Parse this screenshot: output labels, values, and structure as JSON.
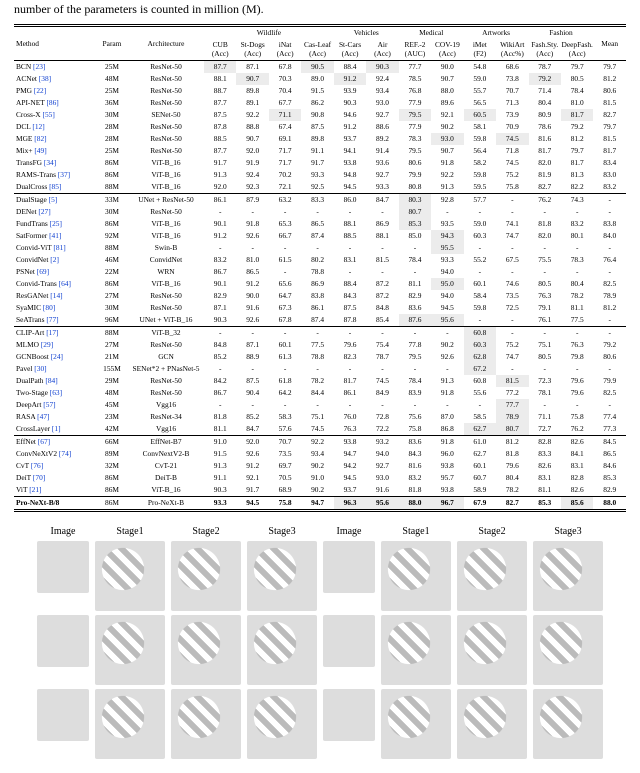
{
  "caption_tail": "number of the parameters is counted in million (M).",
  "head": {
    "method": "Method",
    "param": "Param",
    "arch": "Architecture",
    "groups": [
      {
        "name": "Wildlife",
        "cols": [
          [
            "CUB",
            "(Acc)"
          ],
          [
            "St-Dogs",
            "(Acc)"
          ],
          [
            "iNat",
            "(Acc)"
          ],
          [
            "Cas-Leaf",
            "(Acc)"
          ]
        ]
      },
      {
        "name": "Vehicles",
        "cols": [
          [
            "St-Cars",
            "(Acc)"
          ],
          [
            "Air",
            "(Acc)"
          ]
        ]
      },
      {
        "name": "Medical",
        "cols": [
          [
            "REF.-2",
            "(AUC)"
          ],
          [
            "COV-19",
            "(Acc)"
          ]
        ]
      },
      {
        "name": "Artworks",
        "cols": [
          [
            "iMet",
            "(F2)"
          ],
          [
            "WikiArt",
            "(Acc%)"
          ]
        ]
      },
      {
        "name": "Fashion",
        "cols": [
          [
            "Fash.Sty.",
            "(Acc)"
          ],
          [
            "DeepFash.",
            "(Acc)"
          ]
        ]
      }
    ],
    "mean": "Mean"
  },
  "chart_data": {
    "type": "table",
    "blocks": [
      [
        {
          "m": "BCN",
          "c": "[23]",
          "p": "25M",
          "a": "ResNet-50",
          "v": [
            "87.7",
            "87.1",
            "67.8",
            "90.5",
            "88.4",
            "90.3",
            "77.7",
            "90.0",
            "54.8",
            "68.6",
            "78.7",
            "79.7"
          ],
          "mean": "79.7",
          "hi": [
            0,
            3,
            5
          ]
        },
        {
          "m": "ACNet",
          "c": "[38]",
          "p": "48M",
          "a": "ResNet-50",
          "v": [
            "88.1",
            "90.7",
            "70.3",
            "89.0",
            "91.2",
            "92.4",
            "78.5",
            "90.7",
            "59.0",
            "73.8",
            "79.2",
            "80.5"
          ],
          "mean": "81.2",
          "hi": [
            1,
            4,
            10
          ]
        },
        {
          "m": "PMG",
          "c": "[22]",
          "p": "25M",
          "a": "ResNet-50",
          "v": [
            "88.7",
            "89.8",
            "70.4",
            "91.5",
            "93.9",
            "93.4",
            "76.8",
            "88.0",
            "55.7",
            "70.7",
            "71.4",
            "78.4"
          ],
          "mean": "80.6",
          "hi": []
        },
        {
          "m": "API-NET",
          "c": "[86]",
          "p": "36M",
          "a": "ResNet-50",
          "v": [
            "87.7",
            "89.1",
            "67.7",
            "86.2",
            "90.3",
            "93.0",
            "77.9",
            "89.6",
            "56.5",
            "71.3",
            "80.4",
            "81.0"
          ],
          "mean": "81.5",
          "hi": []
        },
        {
          "m": "Cross-X",
          "c": "[55]",
          "p": "30M",
          "a": "SENet-50",
          "v": [
            "87.5",
            "92.2",
            "71.1",
            "90.8",
            "94.6",
            "92.7",
            "79.5",
            "92.1",
            "60.5",
            "73.9",
            "80.9",
            "81.7"
          ],
          "mean": "82.7",
          "hi": [
            2,
            6,
            8,
            11
          ]
        },
        {
          "m": "DCL",
          "c": "[12]",
          "p": "28M",
          "a": "ResNet-50",
          "v": [
            "87.8",
            "88.8",
            "67.4",
            "87.5",
            "91.2",
            "88.6",
            "77.9",
            "90.2",
            "58.1",
            "70.9",
            "78.6",
            "79.2"
          ],
          "mean": "79.7",
          "hi": []
        },
        {
          "m": "MGE",
          "c": "[82]",
          "p": "28M",
          "a": "ResNet-50",
          "v": [
            "88.5",
            "90.7",
            "69.1",
            "89.8",
            "93.7",
            "89.2",
            "78.3",
            "93.0",
            "59.8",
            "74.5",
            "81.6",
            "81.2"
          ],
          "mean": "81.5",
          "hi": [
            7,
            9
          ]
        },
        {
          "m": "Mix+",
          "c": "[49]",
          "p": "25M",
          "a": "ResNet-50",
          "v": [
            "87.7",
            "92.0",
            "71.7",
            "91.1",
            "94.1",
            "91.4",
            "79.5",
            "90.7",
            "56.4",
            "71.8",
            "81.7",
            "79.7"
          ],
          "mean": "81.7",
          "hi": []
        },
        {
          "m": "TransFG",
          "c": "[34]",
          "p": "86M",
          "a": "ViT-B_16",
          "v": [
            "91.7",
            "91.9",
            "71.7",
            "91.7",
            "93.8",
            "93.6",
            "80.6",
            "91.8",
            "58.2",
            "74.5",
            "82.0",
            "81.7"
          ],
          "mean": "83.4",
          "hi": []
        },
        {
          "m": "RAMS-Trans",
          "c": "[37]",
          "p": "86M",
          "a": "ViT-B_16",
          "v": [
            "91.3",
            "92.4",
            "70.2",
            "93.3",
            "94.8",
            "92.7",
            "79.9",
            "92.2",
            "59.8",
            "75.2",
            "81.9",
            "81.3"
          ],
          "mean": "83.0",
          "hi": []
        },
        {
          "m": "DualCross",
          "c": "[85]",
          "p": "88M",
          "a": "ViT-B_16",
          "v": [
            "92.0",
            "92.3",
            "72.1",
            "92.5",
            "94.5",
            "93.3",
            "80.8",
            "91.3",
            "59.5",
            "75.8",
            "82.7",
            "82.2"
          ],
          "mean": "83.2",
          "hi": []
        }
      ],
      [
        {
          "m": "DualStage",
          "c": "[5]",
          "p": "33M",
          "a": "UNet + ResNet-50",
          "v": [
            "86.1",
            "87.9",
            "63.2",
            "83.3",
            "86.0",
            "84.7",
            "80.3",
            "92.8",
            "57.7",
            "-",
            "76.2",
            "74.3"
          ],
          "mean": "-",
          "hi": [
            6
          ]
        },
        {
          "m": "DENet",
          "c": "[27]",
          "p": "30M",
          "a": "ResNet-50",
          "v": [
            "-",
            "-",
            "-",
            "-",
            "-",
            "-",
            "80.7",
            "-",
            "-",
            "-",
            "-",
            "-"
          ],
          "mean": "-",
          "hi": [
            6
          ]
        },
        {
          "m": "FundTrans",
          "c": "[25]",
          "p": "86M",
          "a": "ViT-B_16",
          "v": [
            "90.1",
            "91.8",
            "65.3",
            "86.5",
            "88.1",
            "86.9",
            "85.3",
            "93.5",
            "59.0",
            "74.1",
            "81.8",
            "83.2"
          ],
          "mean": "83.8",
          "hi": [
            6
          ]
        },
        {
          "m": "SatFormer",
          "c": "[41]",
          "p": "92M",
          "a": "ViT-B_16",
          "v": [
            "91.2",
            "92.6",
            "66.7",
            "87.4",
            "88.5",
            "88.1",
            "85.0",
            "94.3",
            "60.3",
            "74.7",
            "82.0",
            "80.1"
          ],
          "mean": "84.0",
          "hi": [
            7
          ]
        },
        {
          "m": "Convid-ViT",
          "c": "[81]",
          "p": "88M",
          "a": "Swin-B",
          "v": [
            "-",
            "-",
            "-",
            "-",
            "-",
            "-",
            "-",
            "95.5",
            "-",
            "-",
            "-",
            "-"
          ],
          "mean": "-",
          "hi": [
            7
          ]
        },
        {
          "m": "ConvidNet",
          "c": "[2]",
          "p": "46M",
          "a": "ConvidNet",
          "v": [
            "83.2",
            "81.0",
            "61.5",
            "80.2",
            "83.1",
            "81.5",
            "78.4",
            "93.3",
            "55.2",
            "67.5",
            "75.5",
            "78.3"
          ],
          "mean": "76.4",
          "hi": []
        },
        {
          "m": "PSNet",
          "c": "[69]",
          "p": "22M",
          "a": "WRN",
          "v": [
            "86.7",
            "86.5",
            "-",
            "78.8",
            "-",
            "-",
            "-",
            "94.0",
            "-",
            "-",
            "-",
            "-"
          ],
          "mean": "-",
          "hi": []
        },
        {
          "m": "Convid-Trans",
          "c": "[64]",
          "p": "86M",
          "a": "ViT-B_16",
          "v": [
            "90.1",
            "91.2",
            "65.6",
            "86.9",
            "88.4",
            "87.2",
            "81.1",
            "95.0",
            "60.1",
            "74.6",
            "80.5",
            "80.4"
          ],
          "mean": "82.5",
          "hi": [
            7
          ]
        },
        {
          "m": "ResGANet",
          "c": "[14]",
          "p": "27M",
          "a": "ResNet-50",
          "v": [
            "82.9",
            "90.0",
            "64.7",
            "83.8",
            "84.3",
            "87.2",
            "82.9",
            "94.0",
            "58.4",
            "73.5",
            "76.3",
            "78.2"
          ],
          "mean": "78.9",
          "hi": []
        },
        {
          "m": "SyaMIC",
          "c": "[80]",
          "p": "30M",
          "a": "ResNet-50",
          "v": [
            "87.1",
            "91.6",
            "67.3",
            "86.1",
            "87.5",
            "84.8",
            "83.6",
            "94.5",
            "59.8",
            "72.5",
            "79.1",
            "81.1"
          ],
          "mean": "81.2",
          "hi": []
        },
        {
          "m": "SeATrans",
          "c": "[77]",
          "p": "96M",
          "a": "UNet + ViT-B_16",
          "v": [
            "90.3",
            "92.6",
            "67.8",
            "87.4",
            "87.8",
            "85.4",
            "87.6",
            "95.6",
            "-",
            "-",
            "76.1",
            "77.5"
          ],
          "mean": "-",
          "hi": [
            6,
            7
          ]
        }
      ],
      [
        {
          "m": "CLIP-Art",
          "c": "[17]",
          "p": "88M",
          "a": "ViT-B_32",
          "v": [
            "-",
            "-",
            "-",
            "-",
            "-",
            "-",
            "-",
            "-",
            "60.8",
            "-",
            "-",
            "-"
          ],
          "mean": "-",
          "hi": [
            8
          ]
        },
        {
          "m": "MLMO",
          "c": "[29]",
          "p": "27M",
          "a": "ResNet-50",
          "v": [
            "84.8",
            "87.1",
            "60.1",
            "77.5",
            "79.6",
            "75.4",
            "77.8",
            "90.2",
            "60.3",
            "75.2",
            "75.1",
            "76.3"
          ],
          "mean": "79.2",
          "hi": [
            8
          ]
        },
        {
          "m": "GCNBoost",
          "c": "[24]",
          "p": "21M",
          "a": "GCN",
          "v": [
            "85.2",
            "88.9",
            "61.3",
            "78.8",
            "82.3",
            "78.7",
            "79.5",
            "92.6",
            "62.8",
            "74.7",
            "80.5",
            "79.8"
          ],
          "mean": "80.6",
          "hi": [
            8
          ]
        },
        {
          "m": "Pavel",
          "c": "[30]",
          "p": "155M",
          "a": "SENet*2 + PNasNet-5",
          "v": [
            "-",
            "-",
            "-",
            "-",
            "-",
            "-",
            "-",
            "-",
            "67.2",
            "-",
            "-",
            "-"
          ],
          "mean": "-",
          "hi": [
            8
          ]
        },
        {
          "m": "DualPath",
          "c": "[84]",
          "p": "29M",
          "a": "ResNet-50",
          "v": [
            "84.2",
            "87.5",
            "61.8",
            "78.2",
            "81.7",
            "74.5",
            "78.4",
            "91.3",
            "60.8",
            "81.5",
            "72.3",
            "79.6"
          ],
          "mean": "79.9",
          "hi": [
            9
          ]
        },
        {
          "m": "Two-Stage",
          "c": "[63]",
          "p": "48M",
          "a": "ResNet-50",
          "v": [
            "86.7",
            "90.4",
            "64.2",
            "84.4",
            "86.1",
            "84.9",
            "83.9",
            "91.8",
            "55.6",
            "77.2",
            "78.1",
            "79.6"
          ],
          "mean": "82.5",
          "hi": []
        },
        {
          "m": "DeepArt",
          "c": "[57]",
          "p": "45M",
          "a": "Vgg16",
          "v": [
            "-",
            "-",
            "-",
            "-",
            "-",
            "-",
            "-",
            "-",
            "-",
            "77.7",
            "-",
            "-"
          ],
          "mean": "-",
          "hi": [
            9
          ]
        },
        {
          "m": "RASA",
          "c": "[47]",
          "p": "23M",
          "a": "ResNet-34",
          "v": [
            "81.8",
            "85.2",
            "58.3",
            "75.1",
            "76.0",
            "72.8",
            "75.6",
            "87.0",
            "58.5",
            "78.9",
            "71.1",
            "75.8"
          ],
          "mean": "77.4",
          "hi": [
            9
          ]
        },
        {
          "m": "CrossLayer",
          "c": "[1]",
          "p": "42M",
          "a": "Vgg16",
          "v": [
            "81.1",
            "84.7",
            "57.6",
            "74.5",
            "76.3",
            "72.2",
            "75.8",
            "86.8",
            "62.7",
            "80.7",
            "72.7",
            "76.2"
          ],
          "mean": "77.3",
          "hi": [
            8,
            9
          ]
        }
      ],
      [
        {
          "m": "EffNet",
          "c": "[67]",
          "p": "66M",
          "a": "EffNet-B7",
          "v": [
            "91.0",
            "92.0",
            "70.7",
            "92.2",
            "93.8",
            "93.2",
            "83.6",
            "91.8",
            "61.0",
            "81.2",
            "82.8",
            "82.6"
          ],
          "mean": "84.5",
          "hi": []
        },
        {
          "m": "ConvNeXtV2",
          "c": "[74]",
          "p": "89M",
          "a": "ConvNextV2-B",
          "v": [
            "91.5",
            "92.6",
            "73.5",
            "93.4",
            "94.7",
            "94.0",
            "84.3",
            "96.0",
            "62.7",
            "81.8",
            "83.3",
            "84.1"
          ],
          "mean": "86.5",
          "hi": []
        },
        {
          "m": "CvT",
          "c": "[76]",
          "p": "32M",
          "a": "CvT-21",
          "v": [
            "91.3",
            "91.2",
            "69.7",
            "90.2",
            "94.2",
            "92.7",
            "81.6",
            "93.8",
            "60.1",
            "79.6",
            "82.6",
            "83.1"
          ],
          "mean": "84.6",
          "hi": []
        },
        {
          "m": "DeiT",
          "c": "[70]",
          "p": "86M",
          "a": "DeiT-B",
          "v": [
            "91.1",
            "92.1",
            "70.5",
            "91.0",
            "94.5",
            "93.0",
            "83.2",
            "95.7",
            "60.7",
            "80.4",
            "83.1",
            "82.8"
          ],
          "mean": "85.3",
          "hi": []
        },
        {
          "m": "ViT",
          "c": "[21]",
          "p": "86M",
          "a": "ViT-B_16",
          "v": [
            "90.3",
            "91.7",
            "68.9",
            "90.2",
            "93.7",
            "91.6",
            "81.8",
            "93.8",
            "58.9",
            "78.2",
            "81.1",
            "82.6"
          ],
          "mean": "82.9",
          "hi": []
        }
      ],
      [
        {
          "m": "Pro-NeXt-B/8",
          "c": "",
          "p": "86M",
          "a": "Pro-NeXt-B",
          "v": [
            "93.3",
            "94.5",
            "75.8",
            "94.7",
            "96.3",
            "95.6",
            "88.0",
            "96.7",
            "67.9",
            "82.7",
            "85.3",
            "85.6"
          ],
          "mean": "88.0",
          "bold": true,
          "hi": [
            4,
            5,
            6,
            7,
            11
          ]
        }
      ]
    ]
  },
  "grid_labels": [
    "Image",
    "Stage1",
    "Stage2",
    "Stage3",
    "Image",
    "Stage1",
    "Stage2",
    "Stage3"
  ]
}
